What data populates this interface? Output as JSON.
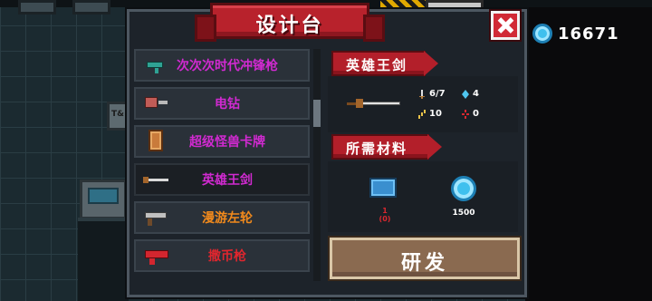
{
  "title": "设计台",
  "currency": {
    "gems": "16671",
    "icon": "gem-icon"
  },
  "background": {
    "sign_text": "T&"
  },
  "weapons": [
    {
      "label": "次次次时代冲锋枪",
      "color": "#d12ad1",
      "icon": "smg-icon",
      "selected": false
    },
    {
      "label": "电钻",
      "color": "#d12ad1",
      "icon": "drill-icon",
      "selected": false
    },
    {
      "label": "超级怪兽卡牌",
      "color": "#d12ad1",
      "icon": "card-icon",
      "selected": false
    },
    {
      "label": "英雄王剑",
      "color": "#d12ad1",
      "icon": "sword-icon",
      "selected": true
    },
    {
      "label": "漫游左轮",
      "color": "#f28a1c",
      "icon": "revolver-icon",
      "selected": false
    },
    {
      "label": "撒币枪",
      "color": "#e0262e",
      "icon": "coin-gun-icon",
      "selected": false
    }
  ],
  "detail": {
    "name": "英雄王剑",
    "stats": {
      "damage": "6/7",
      "energy": "4",
      "crit": "10",
      "accuracy": "0"
    },
    "materials_label": "所需材料",
    "materials": [
      {
        "icon": "material-chip-icon",
        "need": "1",
        "have": "(0)",
        "color": "#d8282f"
      },
      {
        "icon": "gem-icon",
        "cost": "1500",
        "color": "#ffffff"
      }
    ],
    "craft_label": "研发"
  },
  "colors": {
    "accent_red": "#b31f2a",
    "panel": "#1d232a",
    "button": "#8a6a50"
  }
}
